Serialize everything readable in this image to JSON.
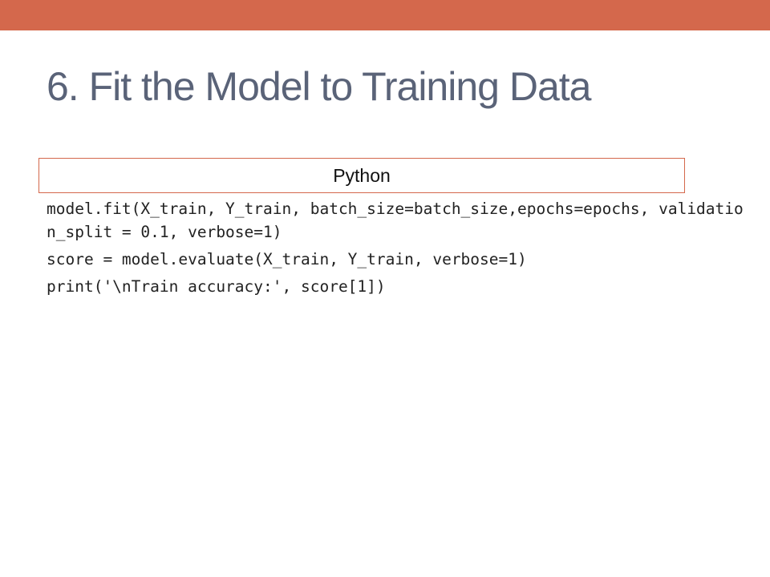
{
  "slide": {
    "title": "6.  Fit the Model to Training Data",
    "accent_color": "#d4684c",
    "title_color": "#5a6378"
  },
  "code_box": {
    "language_label": "Python",
    "lines": [
      "model.fit(X_train, Y_train, batch_size=batch_size,epochs=epochs, validation_split = 0.1, verbose=1)",
      "score = model.evaluate(X_train, Y_train, verbose=1)",
      "print('\\nTrain accuracy:', score[1])"
    ]
  }
}
